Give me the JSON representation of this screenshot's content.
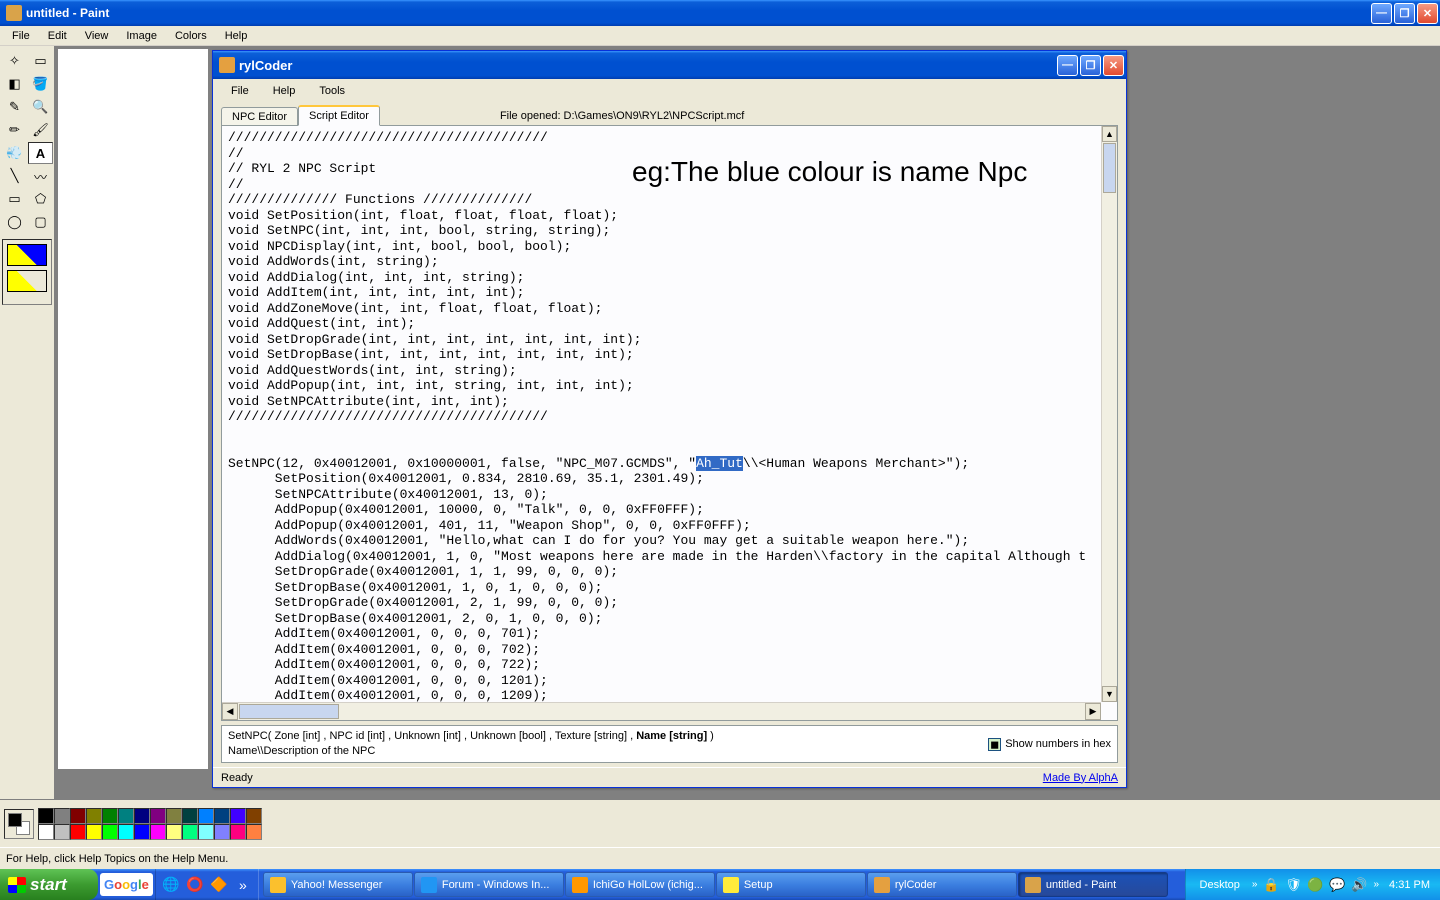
{
  "paint": {
    "title": "untitled - Paint",
    "menu": [
      "File",
      "Edit",
      "View",
      "Image",
      "Colors",
      "Help"
    ],
    "status": "For Help, click Help Topics on the Help Menu.",
    "palette_row1": [
      "#000000",
      "#808080",
      "#800000",
      "#808000",
      "#008000",
      "#008080",
      "#000080",
      "#800080",
      "#808040",
      "#004040",
      "#0080ff",
      "#004080",
      "#4000ff",
      "#804000"
    ],
    "palette_row2": [
      "#ffffff",
      "#c0c0c0",
      "#ff0000",
      "#ffff00",
      "#00ff00",
      "#00ffff",
      "#0000ff",
      "#ff00ff",
      "#ffff80",
      "#00ff80",
      "#80ffff",
      "#8080ff",
      "#ff0080",
      "#ff8040"
    ]
  },
  "ryl": {
    "title": "rylCoder",
    "menu": [
      "File",
      "Help",
      "Tools"
    ],
    "tabs": [
      "NPC Editor",
      "Script Editor"
    ],
    "active_tab": 1,
    "file_opened_label": "File opened: D:\\Games\\ON9\\RYL2\\NPCScript.mcf",
    "annotation": "eg:The blue colour is name Npc",
    "selected_text": "Ah_Tut",
    "code_before_sel": "/////////////////////////////////////////\n//\n// RYL 2 NPC Script\n//\n////////////// Functions //////////////\nvoid SetPosition(int, float, float, float, float);\nvoid SetNPC(int, int, int, bool, string, string);\nvoid NPCDisplay(int, int, bool, bool, bool);\nvoid AddWords(int, string);\nvoid AddDialog(int, int, int, string);\nvoid AddItem(int, int, int, int, int);\nvoid AddZoneMove(int, int, float, float, float);\nvoid AddQuest(int, int);\nvoid SetDropGrade(int, int, int, int, int, int, int);\nvoid SetDropBase(int, int, int, int, int, int, int);\nvoid AddQuestWords(int, int, string);\nvoid AddPopup(int, int, int, string, int, int, int);\nvoid SetNPCAttribute(int, int, int);\n/////////////////////////////////////////\n\n\nSetNPC(12, 0x40012001, 0x10000001, false, \"NPC_M07.GCMDS\", \"",
    "code_after_sel": "\\\\<Human Weapons Merchant>\");\n      SetPosition(0x40012001, 0.834, 2810.69, 35.1, 2301.49);\n      SetNPCAttribute(0x40012001, 13, 0);\n      AddPopup(0x40012001, 10000, 0, \"Talk\", 0, 0, 0xFF0FFF);\n      AddPopup(0x40012001, 401, 11, \"Weapon Shop\", 0, 0, 0xFF0FFF);\n      AddWords(0x40012001, \"Hello,what can I do for you? You may get a suitable weapon here.\");\n      AddDialog(0x40012001, 1, 0, \"Most weapons here are made in the Harden\\\\factory in the capital Although t\n      SetDropGrade(0x40012001, 1, 1, 99, 0, 0, 0);\n      SetDropBase(0x40012001, 1, 0, 1, 0, 0, 0);\n      SetDropGrade(0x40012001, 2, 1, 99, 0, 0, 0);\n      SetDropBase(0x40012001, 2, 0, 1, 0, 0, 0);\n      AddItem(0x40012001, 0, 0, 0, 701);\n      AddItem(0x40012001, 0, 0, 0, 702);\n      AddItem(0x40012001, 0, 0, 0, 722);\n      AddItem(0x40012001, 0, 0, 0, 1201);\n      AddItem(0x40012001, 0, 0, 0, 1209);",
    "signature_a": "SetNPC( Zone [int] , NPC id [int] , Unknown [int] , Unknown [bool] , Texture [string] , ",
    "signature_bold": "Name [string]",
    "signature_b": " )",
    "signature_sub": "Name\\\\Description of the NPC",
    "hex_checkbox": "Show numbers in hex",
    "status_ready": "Ready",
    "madeby": "Made By AlphA"
  },
  "taskbar": {
    "start": "start",
    "google": "Google",
    "tasks": [
      {
        "label": "Yahoo! Messenger",
        "icon": "#fbc02d"
      },
      {
        "label": "Forum - Windows In...",
        "icon": "#2196f3"
      },
      {
        "label": "IchiGo HolLow (ichig...",
        "icon": "#ff9800"
      },
      {
        "label": "Setup",
        "icon": "#ffeb3b"
      },
      {
        "label": "rylCoder",
        "icon": "#e4a040"
      },
      {
        "label": "untitled - Paint",
        "icon": "#d9a34a",
        "active": true
      }
    ],
    "desktop_label": "Desktop",
    "clock": "4:31 PM"
  }
}
